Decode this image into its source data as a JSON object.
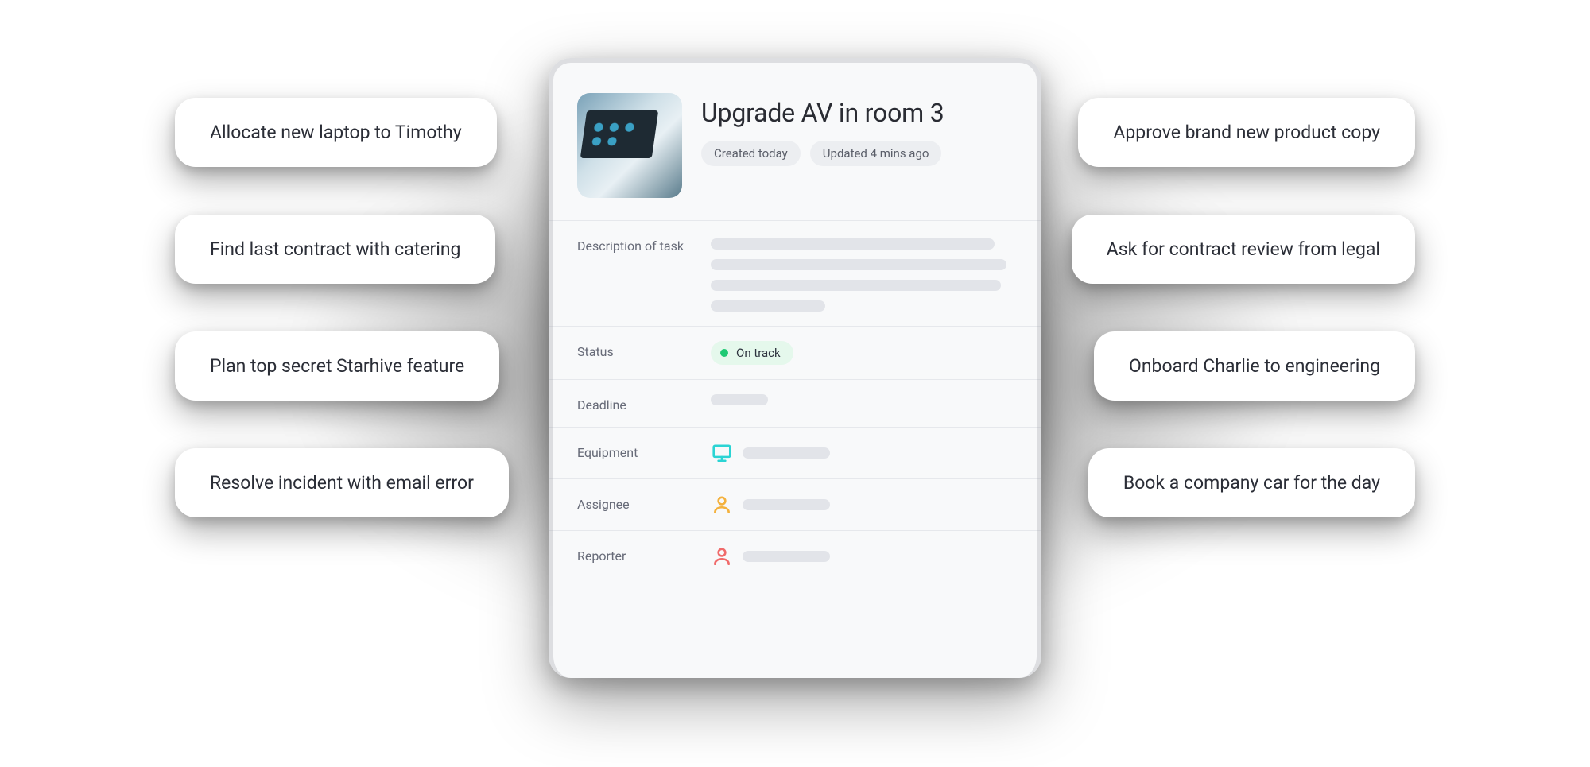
{
  "card": {
    "title": "Upgrade AV in room 3",
    "chips": {
      "created": "Created  today",
      "updated": "Updated 4 mins ago"
    },
    "fields": {
      "description_label": "Description of task",
      "status_label": "Status",
      "status_value": "On track",
      "status_color": "#1EC973",
      "deadline_label": "Deadline",
      "equipment_label": "Equipment",
      "assignee_label": "Assignee",
      "reporter_label": "Reporter"
    },
    "icons": {
      "equipment": "monitor-icon",
      "assignee": "person-icon",
      "reporter": "person-icon"
    },
    "icon_colors": {
      "equipment": "#2BD4D4",
      "assignee": "#F4B23E",
      "reporter": "#F06B6B"
    }
  },
  "left_pills": [
    "Allocate new laptop to Timothy",
    "Find last contract with catering",
    "Plan top secret Starhive feature",
    "Resolve incident with email error"
  ],
  "right_pills": [
    "Approve brand new product copy",
    "Ask for contract review from legal",
    "Onboard Charlie to engineering",
    "Book a company car for the day"
  ]
}
